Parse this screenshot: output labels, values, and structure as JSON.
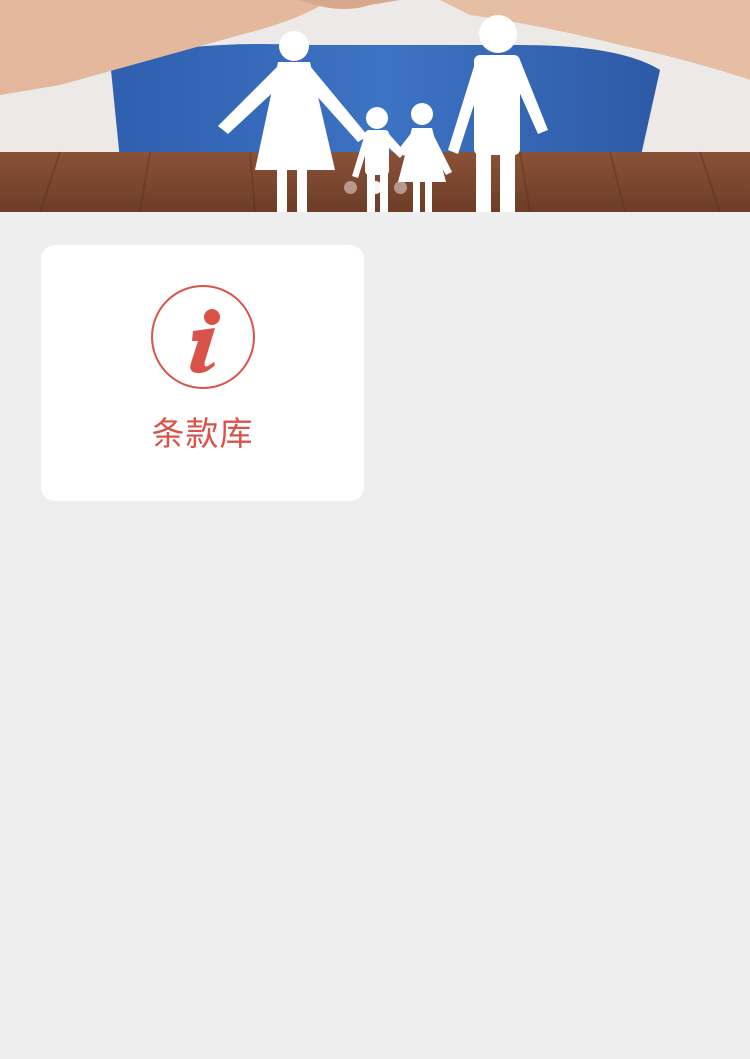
{
  "banner": {
    "slides_total": 3,
    "active_slide": 2
  },
  "menu": {
    "items": [
      {
        "label": "条款库",
        "icon": "info-icon",
        "accent": "#d9534a"
      }
    ]
  }
}
